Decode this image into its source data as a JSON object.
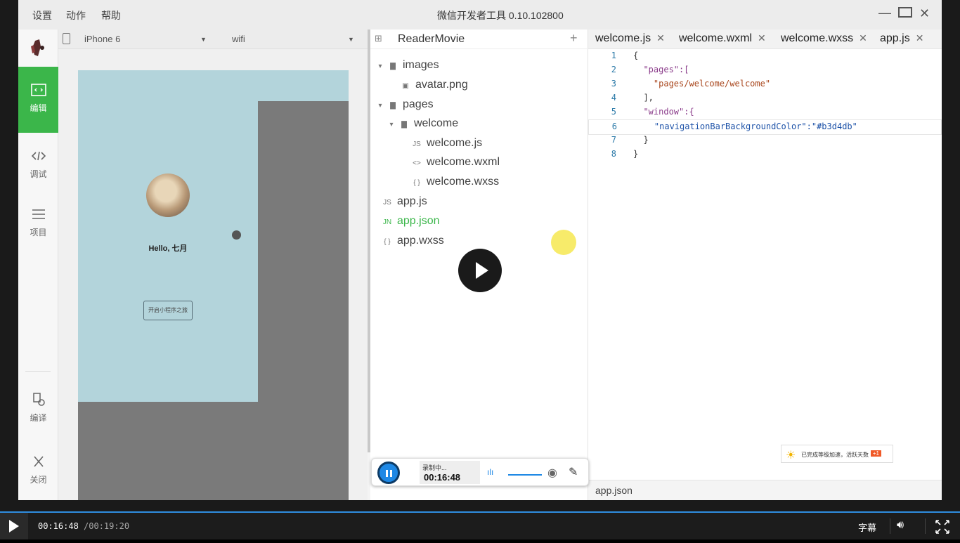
{
  "app": {
    "title": "微信开发者工具 0.10.102800",
    "menu": [
      "设置",
      "动作",
      "帮助"
    ]
  },
  "leftnav": {
    "items": [
      {
        "label": "编辑",
        "icon": "code-window-icon"
      },
      {
        "label": "调试",
        "icon": "code-brackets-icon"
      },
      {
        "label": "项目",
        "icon": "list-icon"
      },
      {
        "label": "编译",
        "icon": "compile-icon"
      },
      {
        "label": "关闭",
        "icon": "close-icon"
      }
    ]
  },
  "device": {
    "model": "iPhone 6",
    "network": "wifi"
  },
  "preview": {
    "nav_color": "#b3d4db",
    "greeting": "Hello, 七月",
    "start_button": "开启小程序之旅"
  },
  "project": {
    "name": "ReaderMovie",
    "tree": [
      {
        "label": "images",
        "type": "folder"
      },
      {
        "label": "avatar.png",
        "type": "image"
      },
      {
        "label": "pages",
        "type": "folder"
      },
      {
        "label": "welcome",
        "type": "folder"
      },
      {
        "label": "welcome.js",
        "type": "js"
      },
      {
        "label": "welcome.wxml",
        "type": "wxml"
      },
      {
        "label": "welcome.wxss",
        "type": "wxss"
      },
      {
        "label": "app.js",
        "type": "js"
      },
      {
        "label": "app.json",
        "type": "json"
      },
      {
        "label": "app.wxss",
        "type": "wxss"
      }
    ]
  },
  "editor": {
    "tabs": [
      "welcome.js",
      "welcome.wxml",
      "welcome.wxss",
      "app.js"
    ],
    "lines": [
      {
        "n": "1",
        "text": "{"
      },
      {
        "n": "2",
        "text": "  \"pages\":["
      },
      {
        "n": "3",
        "text": "    \"pages/welcome/welcome\""
      },
      {
        "n": "4",
        "text": "  ],"
      },
      {
        "n": "5",
        "text": "  \"window\":{"
      },
      {
        "n": "6",
        "text": "    \"navigationBarBackgroundColor\":\"#b3d4db\""
      },
      {
        "n": "7",
        "text": "  }"
      },
      {
        "n": "8",
        "text": "}"
      }
    ],
    "status_file": "app.json"
  },
  "recorder": {
    "label": "录制中...",
    "time": "00:16:48"
  },
  "toast": {
    "text": "已完成等级加速，活跃天数",
    "badge": "+1"
  },
  "player": {
    "current": "00:16:48",
    "total": "/00:19:20",
    "subtitle": "字幕",
    "progress_fraction": 0.869
  }
}
